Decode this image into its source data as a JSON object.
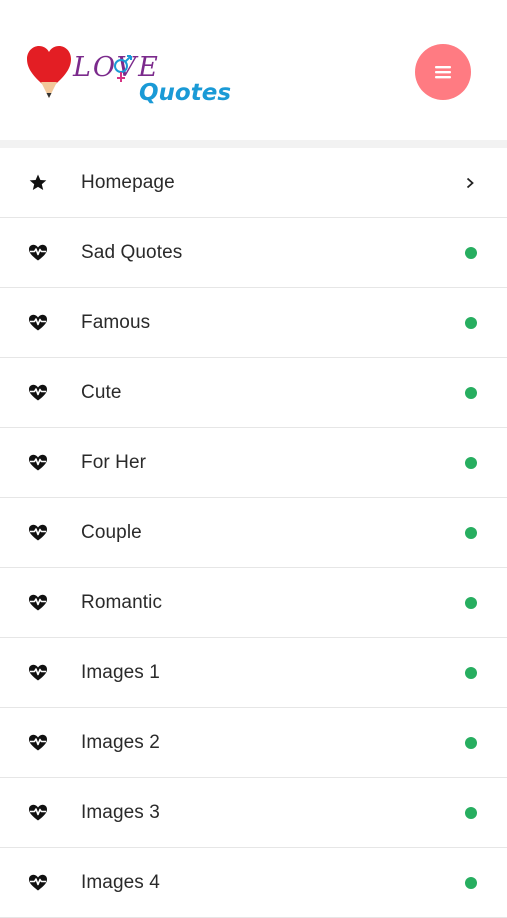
{
  "header": {
    "logo": {
      "word_love": "LOVE",
      "word_quotes": "Quotes",
      "heart_color": "#e31e24",
      "love_color": "#7b2a8c",
      "quotes_color": "#1a9ad6"
    },
    "menu_button": {
      "icon": "hamburger-icon",
      "color": "#ff7b82"
    }
  },
  "menu": {
    "items": [
      {
        "label": "Homepage",
        "icon": "star-icon",
        "indicator": "chevron"
      },
      {
        "label": "Sad Quotes",
        "icon": "heartbeat-icon",
        "indicator": "dot"
      },
      {
        "label": "Famous",
        "icon": "heartbeat-icon",
        "indicator": "dot"
      },
      {
        "label": "Cute",
        "icon": "heartbeat-icon",
        "indicator": "dot"
      },
      {
        "label": "For Her",
        "icon": "heartbeat-icon",
        "indicator": "dot"
      },
      {
        "label": "Couple",
        "icon": "heartbeat-icon",
        "indicator": "dot"
      },
      {
        "label": "Romantic",
        "icon": "heartbeat-icon",
        "indicator": "dot"
      },
      {
        "label": "Images 1",
        "icon": "heartbeat-icon",
        "indicator": "dot"
      },
      {
        "label": "Images 2",
        "icon": "heartbeat-icon",
        "indicator": "dot"
      },
      {
        "label": "Images 3",
        "icon": "heartbeat-icon",
        "indicator": "dot"
      },
      {
        "label": "Images 4",
        "icon": "heartbeat-icon",
        "indicator": "dot"
      }
    ],
    "dot_color": "#27ae60"
  }
}
